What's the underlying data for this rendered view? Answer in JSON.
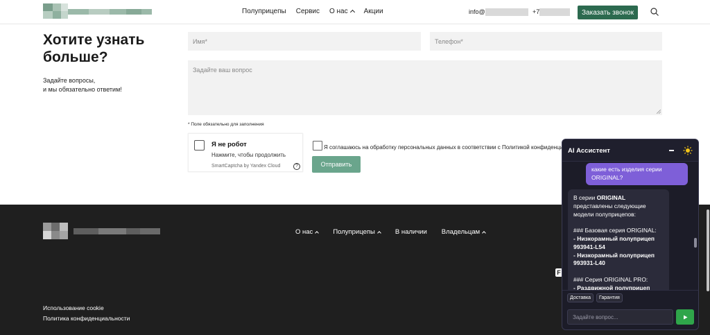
{
  "header": {
    "nav": [
      {
        "label": "Полуприцепы",
        "has_dropdown": false
      },
      {
        "label": "Сервис",
        "has_dropdown": false
      },
      {
        "label": "О нас",
        "has_dropdown": true
      },
      {
        "label": "Акции",
        "has_dropdown": false
      }
    ],
    "email_prefix": "info@",
    "phone_prefix": "+7",
    "call_button": "Заказать звонок",
    "accent_color": "#2c6a4f"
  },
  "form": {
    "title": "Хотите узнать больше?",
    "subtitle_line1": "Задайте вопросы,",
    "subtitle_line2": "и мы обязательно ответим!",
    "name_placeholder": "Имя*",
    "phone_placeholder": "Телефон*",
    "question_placeholder": "Задайте ваш вопрос",
    "required_note": "* Поле обязательно для заполнения",
    "captcha": {
      "title": "Я не робот",
      "hint": "Нажмите, чтобы продолжить",
      "brand": "SmartCaptcha by Yandex Cloud",
      "help": "?"
    },
    "consent": "Я соглашаюсь на обработку персональных данных в соответствии с Политикой конфиденциальности",
    "submit": "Отправить"
  },
  "footer": {
    "nav": [
      {
        "label": "О нас",
        "has_dropdown": true
      },
      {
        "label": "Полуприцепы",
        "has_dropdown": true
      },
      {
        "label": "В наличии",
        "has_dropdown": false
      },
      {
        "label": "Владельцам",
        "has_dropdown": true
      }
    ],
    "links": [
      "Использование cookie",
      "Политика конфиденциальности"
    ],
    "badge": "F"
  },
  "assistant": {
    "title": "AI Ассистент",
    "user_message": "какие есть изделия серии ORIGINAL?",
    "bot_message": {
      "intro_prefix": "В серии ",
      "intro_bold": "ORIGINAL",
      "intro_suffix": " представлены следующие модели полуприцепов:",
      "section1": "### Базовая серия ORIGINAL:",
      "item1": "- Низкорамный полуприцеп 993941-L54",
      "item2": "- Низкорамный полуприцеп 993931-L40",
      "section2": "### Серия ORIGINAL PRO:",
      "item3": "- Раздвижной полуприцеп"
    },
    "chips": [
      "Доставка",
      "Гарантия"
    ],
    "input_placeholder": "Задайте вопрос...",
    "send_icon": "send-arrow-icon",
    "theme_icon": "sun-icon"
  }
}
